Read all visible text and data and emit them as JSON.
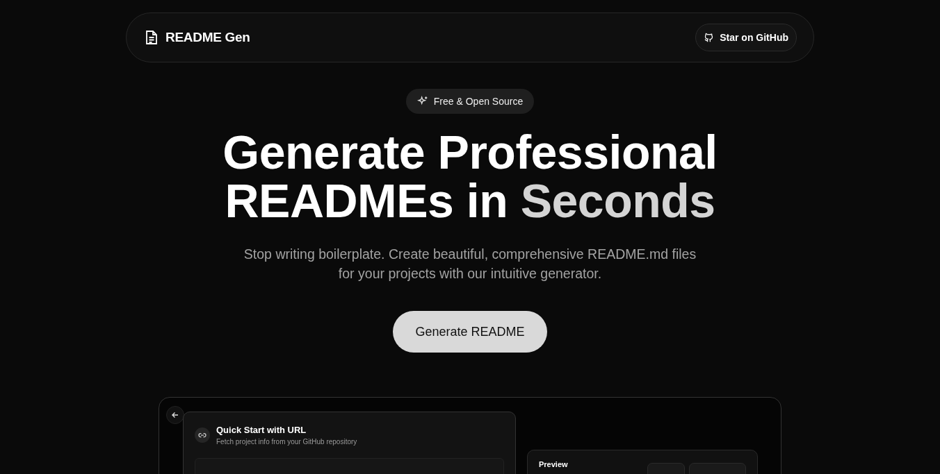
{
  "header": {
    "brand": "README Gen",
    "github_button": "Star on GitHub"
  },
  "hero": {
    "badge": "Free & Open Source",
    "title_line1": "Generate Professional",
    "title_line2_main": "READMEs in",
    "title_line2_accent": "Seconds",
    "subtitle": "Stop writing boilerplate. Create beautiful, comprehensive README.md files for your projects with our intuitive generator.",
    "cta": "Generate README"
  },
  "demo": {
    "quick_start": {
      "title": "Quick Start with URL",
      "description": "Fetch project info from your GitHub repository"
    },
    "preview": {
      "title": "Preview"
    }
  }
}
